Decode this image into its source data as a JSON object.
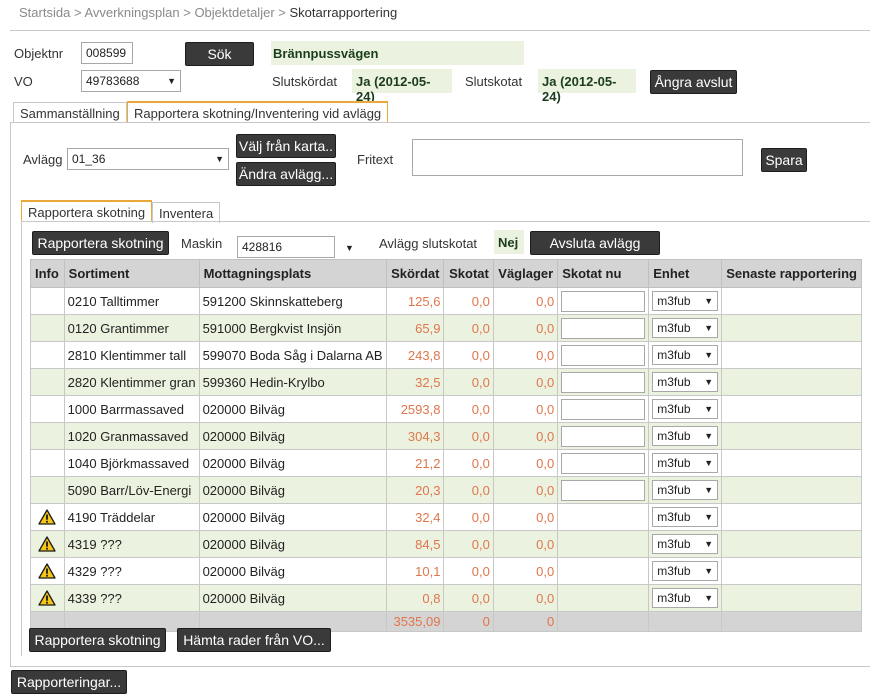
{
  "breadcrumb": {
    "items": [
      "Startsida",
      "Avverkningsplan",
      "Objektdetaljer"
    ],
    "separator": ">",
    "current": "Skotarrapportering"
  },
  "header": {
    "objektnr_label": "Objektnr",
    "objektnr_value": "008599",
    "search_label": "Sök",
    "object_name": "Brännpussvägen",
    "vo_label": "VO",
    "vo_value": "49783688",
    "slutskordat_label": "Slutskördat",
    "slutskordat_value": "Ja (2012-05-24)",
    "slutskotat_label": "Slutskotat",
    "slutskotat_value": "Ja (2012-05-24)",
    "undo_label": "Ångra avslut"
  },
  "tabs": [
    "Sammanställning",
    "Rapportera skotning/Inventering vid avlägg"
  ],
  "avlagg": {
    "label": "Avlägg",
    "value": "01_36",
    "choose_map_label": "Välj från karta..",
    "change_label": "Ändra avlägg...",
    "fritext_label": "Fritext",
    "fritext_value": "",
    "save_label": "Spara"
  },
  "subtabs": [
    "Rapportera skotning",
    "Inventera"
  ],
  "report": {
    "report_label": "Rapportera skotning",
    "maskin_label": "Maskin",
    "maskin_value": "428816",
    "slutskotat_label": "Avlägg slutskotat",
    "slutskotat_value": "Nej",
    "finish_label": "Avsluta avlägg"
  },
  "table": {
    "columns": [
      "Info",
      "Sortiment",
      "Mottagningsplats",
      "Skördat",
      "Skotat",
      "Väglager",
      "Skotat nu",
      "Enhet",
      "Senaste rapportering"
    ],
    "rows": [
      {
        "warn": false,
        "sortiment": "0210 Talltimmer",
        "plats": "591200 Skinnskatteberg",
        "skordat": "125,6",
        "skotat": "0,0",
        "vaglager": "0,0",
        "input": true,
        "enhet": "m3fub",
        "senaste": ""
      },
      {
        "warn": false,
        "sortiment": "0120 Grantimmer",
        "plats": "591000 Bergkvist Insjön",
        "skordat": "65,9",
        "skotat": "0,0",
        "vaglager": "0,0",
        "input": true,
        "enhet": "m3fub",
        "senaste": ""
      },
      {
        "warn": false,
        "sortiment": "2810 Klentimmer tall",
        "plats": "599070 Boda Såg i Dalarna AB",
        "skordat": "243,8",
        "skotat": "0,0",
        "vaglager": "0,0",
        "input": true,
        "enhet": "m3fub",
        "senaste": ""
      },
      {
        "warn": false,
        "sortiment": "2820 Klentimmer gran",
        "plats": "599360 Hedin-Krylbo",
        "skordat": "32,5",
        "skotat": "0,0",
        "vaglager": "0,0",
        "input": true,
        "enhet": "m3fub",
        "senaste": ""
      },
      {
        "warn": false,
        "sortiment": "1000 Barrmassaved",
        "plats": "020000 Bilväg",
        "skordat": "2593,8",
        "skotat": "0,0",
        "vaglager": "0,0",
        "input": true,
        "enhet": "m3fub",
        "senaste": ""
      },
      {
        "warn": false,
        "sortiment": "1020 Granmassaved",
        "plats": "020000 Bilväg",
        "skordat": "304,3",
        "skotat": "0,0",
        "vaglager": "0,0",
        "input": true,
        "enhet": "m3fub",
        "senaste": ""
      },
      {
        "warn": false,
        "sortiment": "1040 Björkmassaved",
        "plats": "020000 Bilväg",
        "skordat": "21,2",
        "skotat": "0,0",
        "vaglager": "0,0",
        "input": true,
        "enhet": "m3fub",
        "senaste": ""
      },
      {
        "warn": false,
        "sortiment": "5090 Barr/Löv-Energi",
        "plats": "020000 Bilväg",
        "skordat": "20,3",
        "skotat": "0,0",
        "vaglager": "0,0",
        "input": true,
        "enhet": "m3fub",
        "senaste": ""
      },
      {
        "warn": true,
        "sortiment": "4190 Träddelar",
        "plats": "020000 Bilväg",
        "skordat": "32,4",
        "skotat": "0,0",
        "vaglager": "0,0",
        "input": false,
        "enhet": "m3fub",
        "senaste": ""
      },
      {
        "warn": true,
        "sortiment": "4319 ???",
        "plats": "020000 Bilväg",
        "skordat": "84,5",
        "skotat": "0,0",
        "vaglager": "0,0",
        "input": false,
        "enhet": "m3fub",
        "senaste": ""
      },
      {
        "warn": true,
        "sortiment": "4329 ???",
        "plats": "020000 Bilväg",
        "skordat": "10,1",
        "skotat": "0,0",
        "vaglager": "0,0",
        "input": false,
        "enhet": "m3fub",
        "senaste": ""
      },
      {
        "warn": true,
        "sortiment": "4339 ???",
        "plats": "020000 Bilväg",
        "skordat": "0,8",
        "skotat": "0,0",
        "vaglager": "0,0",
        "input": false,
        "enhet": "m3fub",
        "senaste": ""
      }
    ],
    "totals": {
      "skordat": "3535,09",
      "skotat": "0",
      "vaglager": "0"
    }
  },
  "bottom": {
    "report_label": "Rapportera skotning",
    "fetch_label": "Hämta rader från VO...",
    "reports_label": "Rapporteringar..."
  },
  "colors": {
    "accent_tab": "#e8a83a",
    "row_alt": "#ebf3e0",
    "number": "#e0764c",
    "button": "#3a3a3a",
    "warning": "#f5c518"
  },
  "icons": {
    "warning": "warning-icon",
    "dropdown": "chevron-down-icon"
  }
}
